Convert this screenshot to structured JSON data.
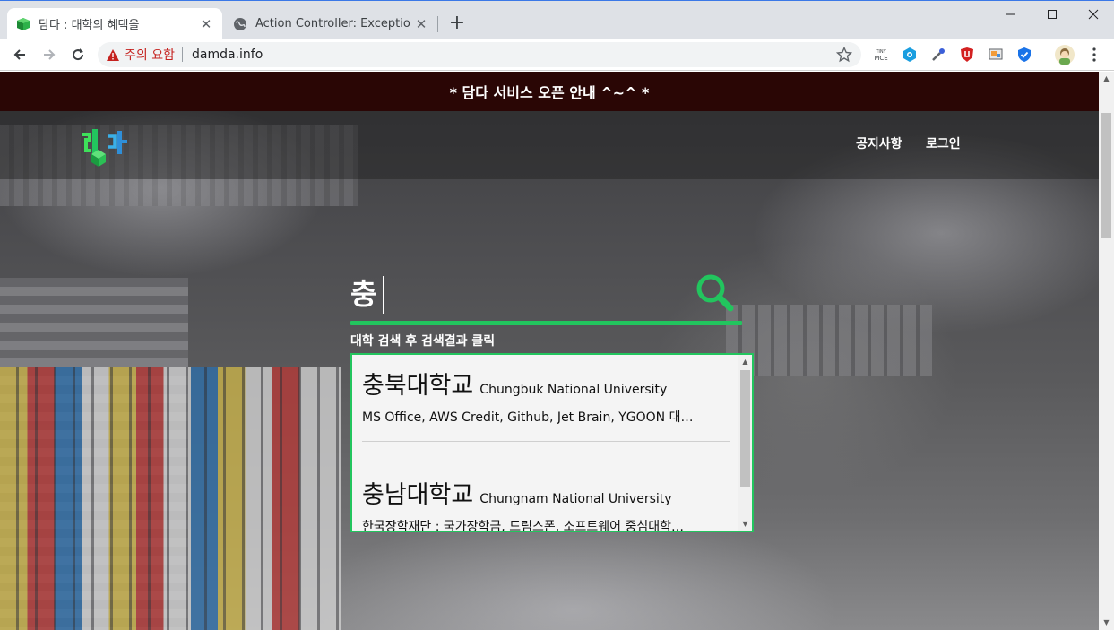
{
  "browser": {
    "tabs": [
      {
        "title": "담다 : 대학의 혜택을",
        "active": true
      },
      {
        "title": "Action Controller: Exception cau",
        "active": false
      }
    ],
    "close_glyph": "✕",
    "new_tab_glyph": "+",
    "window_controls": {
      "minimize": "─",
      "maximize": "☐",
      "close": "✕"
    },
    "address": {
      "security_warning": "주의 요함",
      "url": "damda.info"
    },
    "extensions": [
      "tinymce-icon",
      "eye-extension-icon",
      "eyedropper-icon",
      "ublock-icon",
      "cast-icon",
      "shield-check-icon",
      "avatar"
    ],
    "extension_labels": {
      "tinymce": "TINY MCE"
    }
  },
  "page": {
    "announcement": "* 담다 서비스 오픈 안내 ^~^ *",
    "nav": {
      "notice": "공지사항",
      "login": "로그인"
    },
    "search": {
      "value": "충",
      "hint": "대학 검색 후 검색결과 클릭"
    },
    "results": [
      {
        "name_ko": "충북대학교",
        "name_en": "Chungbuk National University",
        "benefits": "MS Office, AWS Credit, Github, Jet Brain, YGOON 대…"
      },
      {
        "name_ko": "충남대학교",
        "name_en": "Chungnam National University",
        "benefits": "한국장학재단 : 국가장학금, 드림스폰, 소프트웨어 중심대학…"
      }
    ]
  },
  "colors": {
    "accent": "#22c55e",
    "announce_bg": "#2a0605",
    "warning": "#c5221f"
  }
}
